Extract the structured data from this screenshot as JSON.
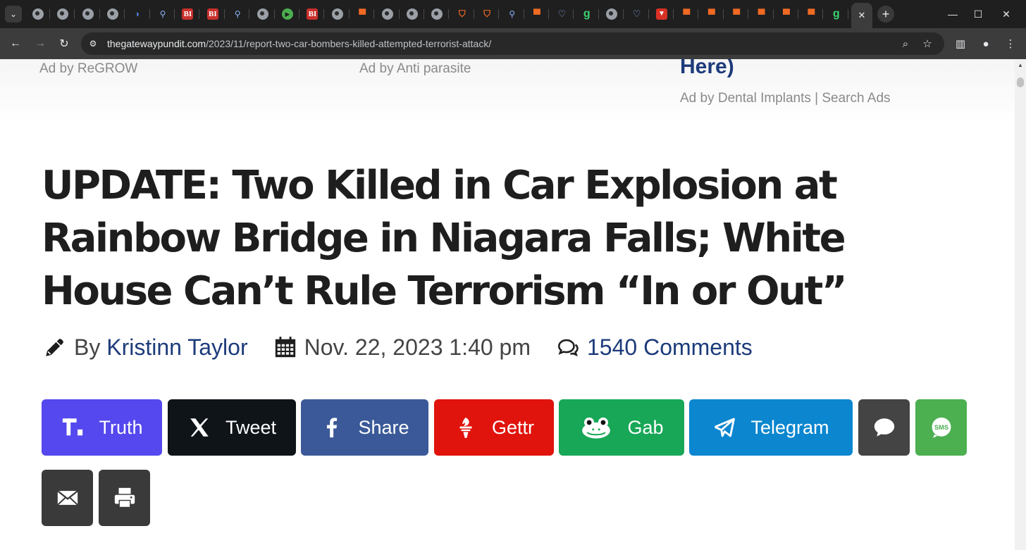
{
  "browser": {
    "tabs": [
      {
        "icon": "globe-icon",
        "type": "globe",
        "glyph": ""
      },
      {
        "icon": "globe-icon",
        "type": "globe",
        "glyph": ""
      },
      {
        "icon": "globe-icon",
        "type": "globe",
        "glyph": ""
      },
      {
        "icon": "globe-icon",
        "type": "globe",
        "glyph": ""
      },
      {
        "icon": "d-shape-icon",
        "type": "dshape",
        "glyph": "◗"
      },
      {
        "icon": "search-icon",
        "type": "srch",
        "glyph": "⚲"
      },
      {
        "icon": "business-insider-icon",
        "type": "bi",
        "glyph": "BI"
      },
      {
        "icon": "business-insider-icon",
        "type": "bi",
        "glyph": "BI"
      },
      {
        "icon": "search-icon",
        "type": "srch",
        "glyph": "⚲"
      },
      {
        "icon": "globe-icon",
        "type": "globe",
        "glyph": ""
      },
      {
        "icon": "play-icon",
        "type": "play",
        "glyph": "▶"
      },
      {
        "icon": "business-insider-icon",
        "type": "bi",
        "glyph": "BI"
      },
      {
        "icon": "globe-icon",
        "type": "globe",
        "glyph": ""
      },
      {
        "icon": "bookmark-icon",
        "type": "bm",
        "glyph": "▀"
      },
      {
        "icon": "globe-icon",
        "type": "globe",
        "glyph": ""
      },
      {
        "icon": "globe-icon",
        "type": "globe",
        "glyph": ""
      },
      {
        "icon": "globe-icon",
        "type": "globe",
        "glyph": ""
      },
      {
        "icon": "shield-icon",
        "type": "shield",
        "glyph": "⛉"
      },
      {
        "icon": "shield-icon",
        "type": "shield",
        "glyph": "⛉"
      },
      {
        "icon": "search-icon",
        "type": "srch",
        "glyph": "⚲"
      },
      {
        "icon": "bookmark-icon",
        "type": "bm",
        "glyph": "▀"
      },
      {
        "icon": "heart-shield-icon",
        "type": "heart",
        "glyph": "♡"
      },
      {
        "icon": "g-icon",
        "type": "g",
        "glyph": "g"
      },
      {
        "icon": "globe-icon",
        "type": "globe",
        "glyph": ""
      },
      {
        "icon": "heart-shield-icon",
        "type": "heart",
        "glyph": "♡"
      },
      {
        "icon": "red-app-icon",
        "type": "red",
        "glyph": "▼"
      },
      {
        "icon": "bookmark-icon",
        "type": "bm",
        "glyph": "▀"
      },
      {
        "icon": "bookmark-icon",
        "type": "bm",
        "glyph": "▀"
      },
      {
        "icon": "bookmark-icon",
        "type": "bm",
        "glyph": "▀"
      },
      {
        "icon": "bookmark-icon",
        "type": "bm",
        "glyph": "▀"
      },
      {
        "icon": "bookmark-icon",
        "type": "bm",
        "glyph": "▀"
      },
      {
        "icon": "bookmark-icon",
        "type": "bm",
        "glyph": "▀"
      },
      {
        "icon": "g-icon",
        "type": "g",
        "glyph": "g"
      }
    ],
    "url_host": "thegatewaypundit.com",
    "url_path": "/2023/11/report-two-car-bombers-killed-attempted-terrorist-attack/"
  },
  "ads": {
    "left_label": "Ad by ReGROW",
    "middle_label": "Ad by Anti parasite",
    "right_title": "Here)",
    "right_label": "Ad by Dental Implants | Search Ads"
  },
  "article": {
    "headline": "UPDATE: Two Killed in Car Explosion at Rainbow Bridge in Niagara Falls; White House Can’t Rule Terrorism “In or Out”",
    "by_prefix": "By",
    "author": "Kristinn Taylor",
    "date": "Nov. 22, 2023 1:40 pm",
    "comments": "1540 Comments"
  },
  "share": {
    "truth": "Truth",
    "tweet": "Tweet",
    "share": "Share",
    "gettr": "Gettr",
    "gab": "Gab",
    "telegram": "Telegram",
    "sms_badge": "SMS"
  },
  "colors": {
    "truth": "#5448ee",
    "tweet": "#0f1419",
    "facebook": "#3b5998",
    "gettr": "#e0140c",
    "gab": "#17a757",
    "telegram": "#0b86cf",
    "chat": "#444444",
    "sms": "#4caf50",
    "email": "#3a3a3a",
    "print": "#3a3a3a",
    "link": "#1d3b7b"
  }
}
